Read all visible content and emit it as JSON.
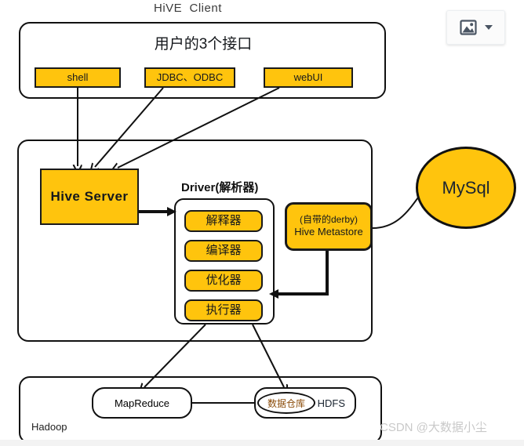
{
  "diagram": {
    "title": "HiVE  Client",
    "client_panel": {
      "heading": "用户的3个接口",
      "interfaces": [
        {
          "label": "shell"
        },
        {
          "label": "JDBC、ODBC"
        },
        {
          "label": "webUI"
        }
      ]
    },
    "server_panel": {
      "hive_server": "Hive  Server",
      "driver_title": "Driver(解析器)",
      "driver_steps": [
        {
          "label": "解释器"
        },
        {
          "label": "编译器"
        },
        {
          "label": "优化器"
        },
        {
          "label": "执行器"
        }
      ],
      "metastore": {
        "line1": "(自带的derby)",
        "line2": "Hive Metastore"
      }
    },
    "database": {
      "label": "MySql"
    },
    "hadoop_panel": {
      "caption": "Hadoop",
      "mapreduce": "MapReduce",
      "hdfs": "HDFS",
      "warehouse": "数据仓库"
    }
  },
  "toolbar": {
    "image_icon": "image-icon",
    "dropdown_icon": "chevron-down-icon"
  },
  "watermark": {
    "text": "CSDN @大数据小尘"
  },
  "colors": {
    "amber": "#FFC40D",
    "stroke": "#111111",
    "watermark": "#c9c9c9"
  }
}
